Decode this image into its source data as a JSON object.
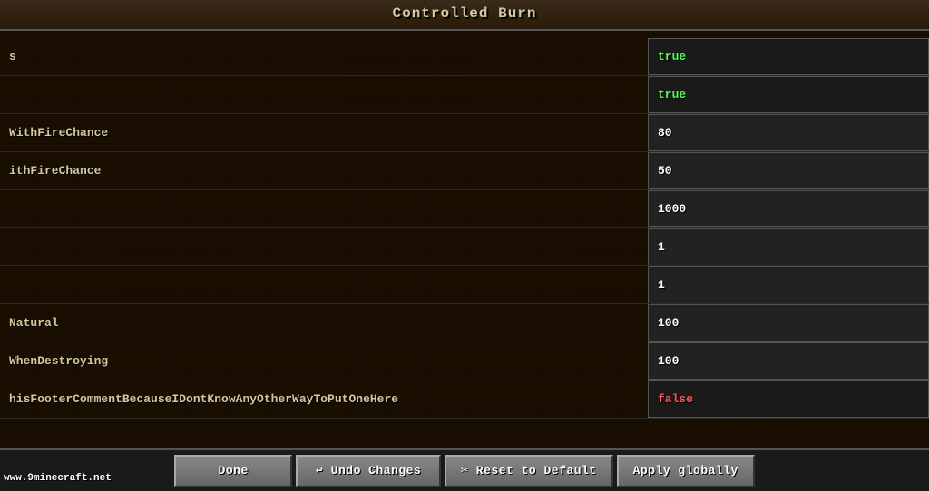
{
  "title": "Controlled Burn",
  "rows": [
    {
      "id": "row1",
      "label": "s",
      "value": "true",
      "valueType": "green",
      "isToggle": true
    },
    {
      "id": "row2",
      "label": "",
      "value": "true",
      "valueType": "green",
      "isToggle": true
    },
    {
      "id": "row3",
      "label": "WithFireChance",
      "value": "80",
      "valueType": "white",
      "isToggle": false
    },
    {
      "id": "row4",
      "label": "ithFireChance",
      "value": "50",
      "valueType": "white",
      "isToggle": false
    },
    {
      "id": "row5",
      "label": "",
      "value": "1000",
      "valueType": "white",
      "isToggle": false
    },
    {
      "id": "row6",
      "label": "",
      "value": "1",
      "valueType": "white",
      "isToggle": false
    },
    {
      "id": "row7",
      "label": "",
      "value": "1",
      "valueType": "white",
      "isToggle": false
    },
    {
      "id": "row8",
      "label": "Natural",
      "value": "100",
      "valueType": "white",
      "isToggle": false
    },
    {
      "id": "row9",
      "label": "WhenDestroying",
      "value": "100",
      "valueType": "white",
      "isToggle": false
    },
    {
      "id": "row10",
      "label": "hisFooterCommentBecauseIDontKnowAnyOtherWayToPutOneHere",
      "value": "false",
      "valueType": "red",
      "isToggle": true
    }
  ],
  "buttons": {
    "done": "Done",
    "undo": "↩ Undo Changes",
    "reset": "✂ Reset to Default",
    "apply": "Apply globally"
  },
  "watermark": "www.9minecraft.net"
}
